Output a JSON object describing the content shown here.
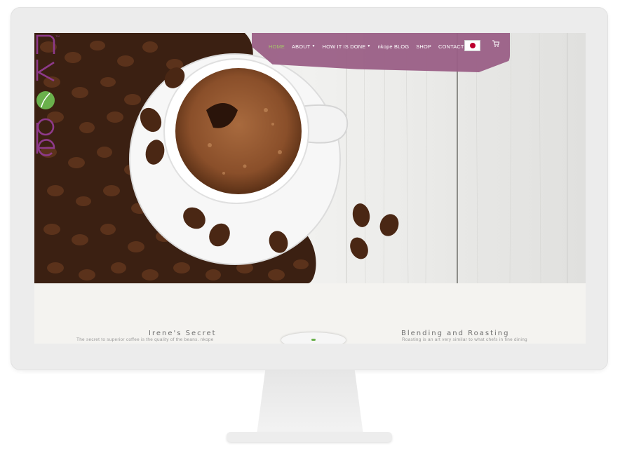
{
  "nav": {
    "items": [
      {
        "label": "HOME",
        "active": true,
        "dropdown": false
      },
      {
        "label": "ABOUT",
        "active": false,
        "dropdown": true
      },
      {
        "label": "HOW IT IS DONE",
        "active": false,
        "dropdown": true
      },
      {
        "label": "nkope BLOG",
        "active": false,
        "dropdown": false
      },
      {
        "label": "SHOP",
        "active": false,
        "dropdown": false
      },
      {
        "label": "CONTACT",
        "active": false,
        "dropdown": false
      }
    ],
    "language_flag": "japan-flag-icon",
    "cart_icon": "cart-icon"
  },
  "brand": {
    "logo_text": "nkope",
    "logo_color": "#8e3a8a",
    "accent_green": "#6ab04c"
  },
  "colors": {
    "nav_brush": "#9a5f86",
    "nav_active": "#a4c46a"
  },
  "features": {
    "left": {
      "title": "Irene's Secret",
      "text": "The secret to superior coffee is the quality of the beans. nkope"
    },
    "right": {
      "title": "Blending and Roasting",
      "text": "Roasting is an art very similar to what chefs in fine dining"
    }
  }
}
